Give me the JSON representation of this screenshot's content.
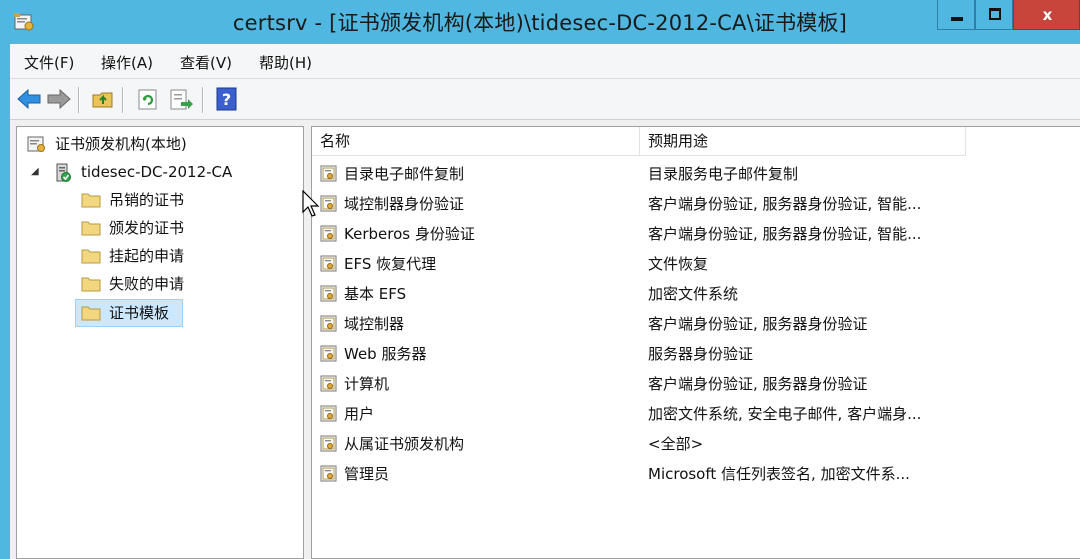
{
  "window": {
    "title": "certsrv - [证书颁发机构(本地)\\tidesec-DC-2012-CA\\证书模板]",
    "close_label": "x"
  },
  "menubar": {
    "items": [
      {
        "label": "文件(F)"
      },
      {
        "label": "操作(A)"
      },
      {
        "label": "查看(V)"
      },
      {
        "label": "帮助(H)"
      }
    ]
  },
  "tree": {
    "root_label": "证书颁发机构(本地)",
    "ca_label": "tidesec-DC-2012-CA",
    "children": [
      {
        "label": "吊销的证书"
      },
      {
        "label": "颁发的证书"
      },
      {
        "label": "挂起的申请"
      },
      {
        "label": "失败的申请"
      },
      {
        "label": "证书模板",
        "selected": true
      }
    ]
  },
  "list": {
    "columns": [
      "名称",
      "预期用途"
    ],
    "rows": [
      {
        "name": "目录电子邮件复制",
        "purpose": "目录服务电子邮件复制"
      },
      {
        "name": "域控制器身份验证",
        "purpose": "客户端身份验证, 服务器身份验证, 智能..."
      },
      {
        "name": "Kerberos 身份验证",
        "purpose": "客户端身份验证, 服务器身份验证, 智能..."
      },
      {
        "name": "EFS 恢复代理",
        "purpose": "文件恢复"
      },
      {
        "name": "基本 EFS",
        "purpose": "加密文件系统"
      },
      {
        "name": "域控制器",
        "purpose": "客户端身份验证, 服务器身份验证"
      },
      {
        "name": "Web 服务器",
        "purpose": "服务器身份验证"
      },
      {
        "name": "计算机",
        "purpose": "客户端身份验证, 服务器身份验证"
      },
      {
        "name": "用户",
        "purpose": "加密文件系统, 安全电子邮件, 客户端身..."
      },
      {
        "name": "从属证书颁发机构",
        "purpose": "<全部>"
      },
      {
        "name": "管理员",
        "purpose": "Microsoft 信任列表签名, 加密文件系..."
      }
    ]
  },
  "colors": {
    "titlebar": "#4fb7e0",
    "close_button": "#c7453a",
    "selection": "#cce8ff"
  }
}
